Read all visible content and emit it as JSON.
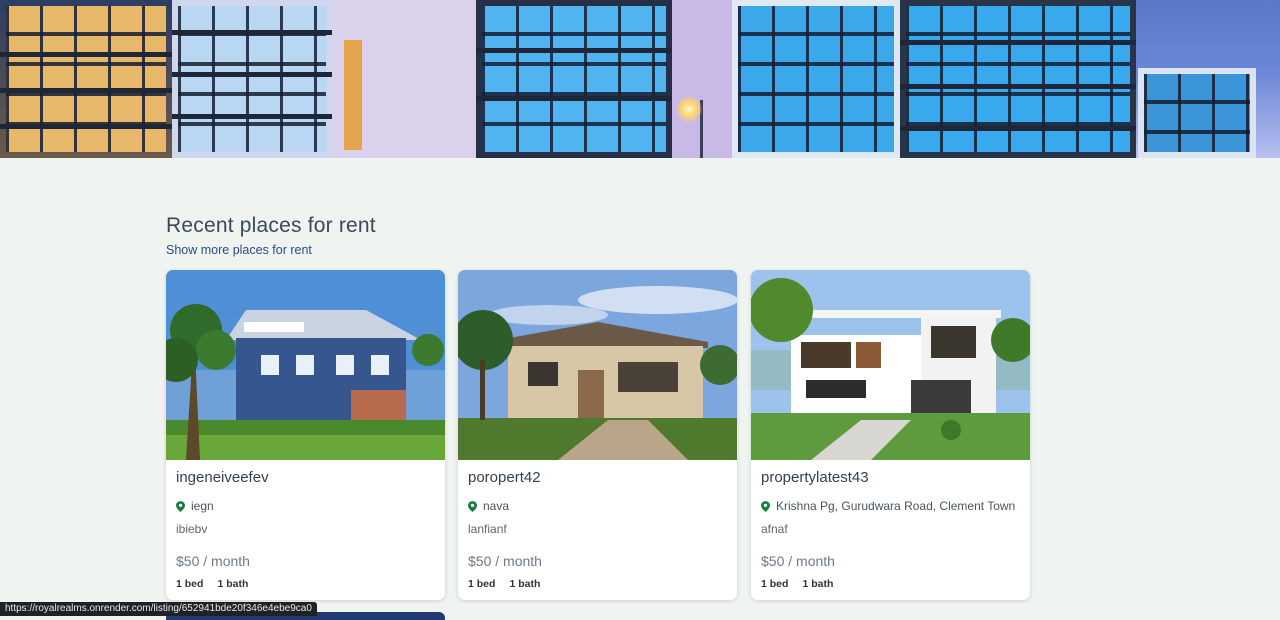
{
  "section": {
    "title": "Recent places for rent",
    "show_more_label": "Show more places for rent"
  },
  "listings": [
    {
      "name": "ingeneiveefev",
      "location": "iegn",
      "description": "ibiebv",
      "price": "$50 / month",
      "beds": "1 bed",
      "baths": "1 bath"
    },
    {
      "name": "poropert42",
      "location": "nava",
      "description": "lanfianf",
      "price": "$50 / month",
      "beds": "1 bed",
      "baths": "1 bath"
    },
    {
      "name": "propertylatest43",
      "location": "Krishna Pg, Gurudwara Road, Clement Town",
      "description": "afnaf",
      "price": "$50 / month",
      "beds": "1 bed",
      "baths": "1 bath"
    }
  ],
  "status_bar": {
    "url": "https://royalrealms.onrender.com/listing/652941bde20f346e4ebe9ca0"
  },
  "colors": {
    "page_background": "#f0f4f1",
    "location_pin": "#15803d",
    "link": "#2b4a86"
  },
  "icons": {
    "location": "map-pin-icon"
  }
}
